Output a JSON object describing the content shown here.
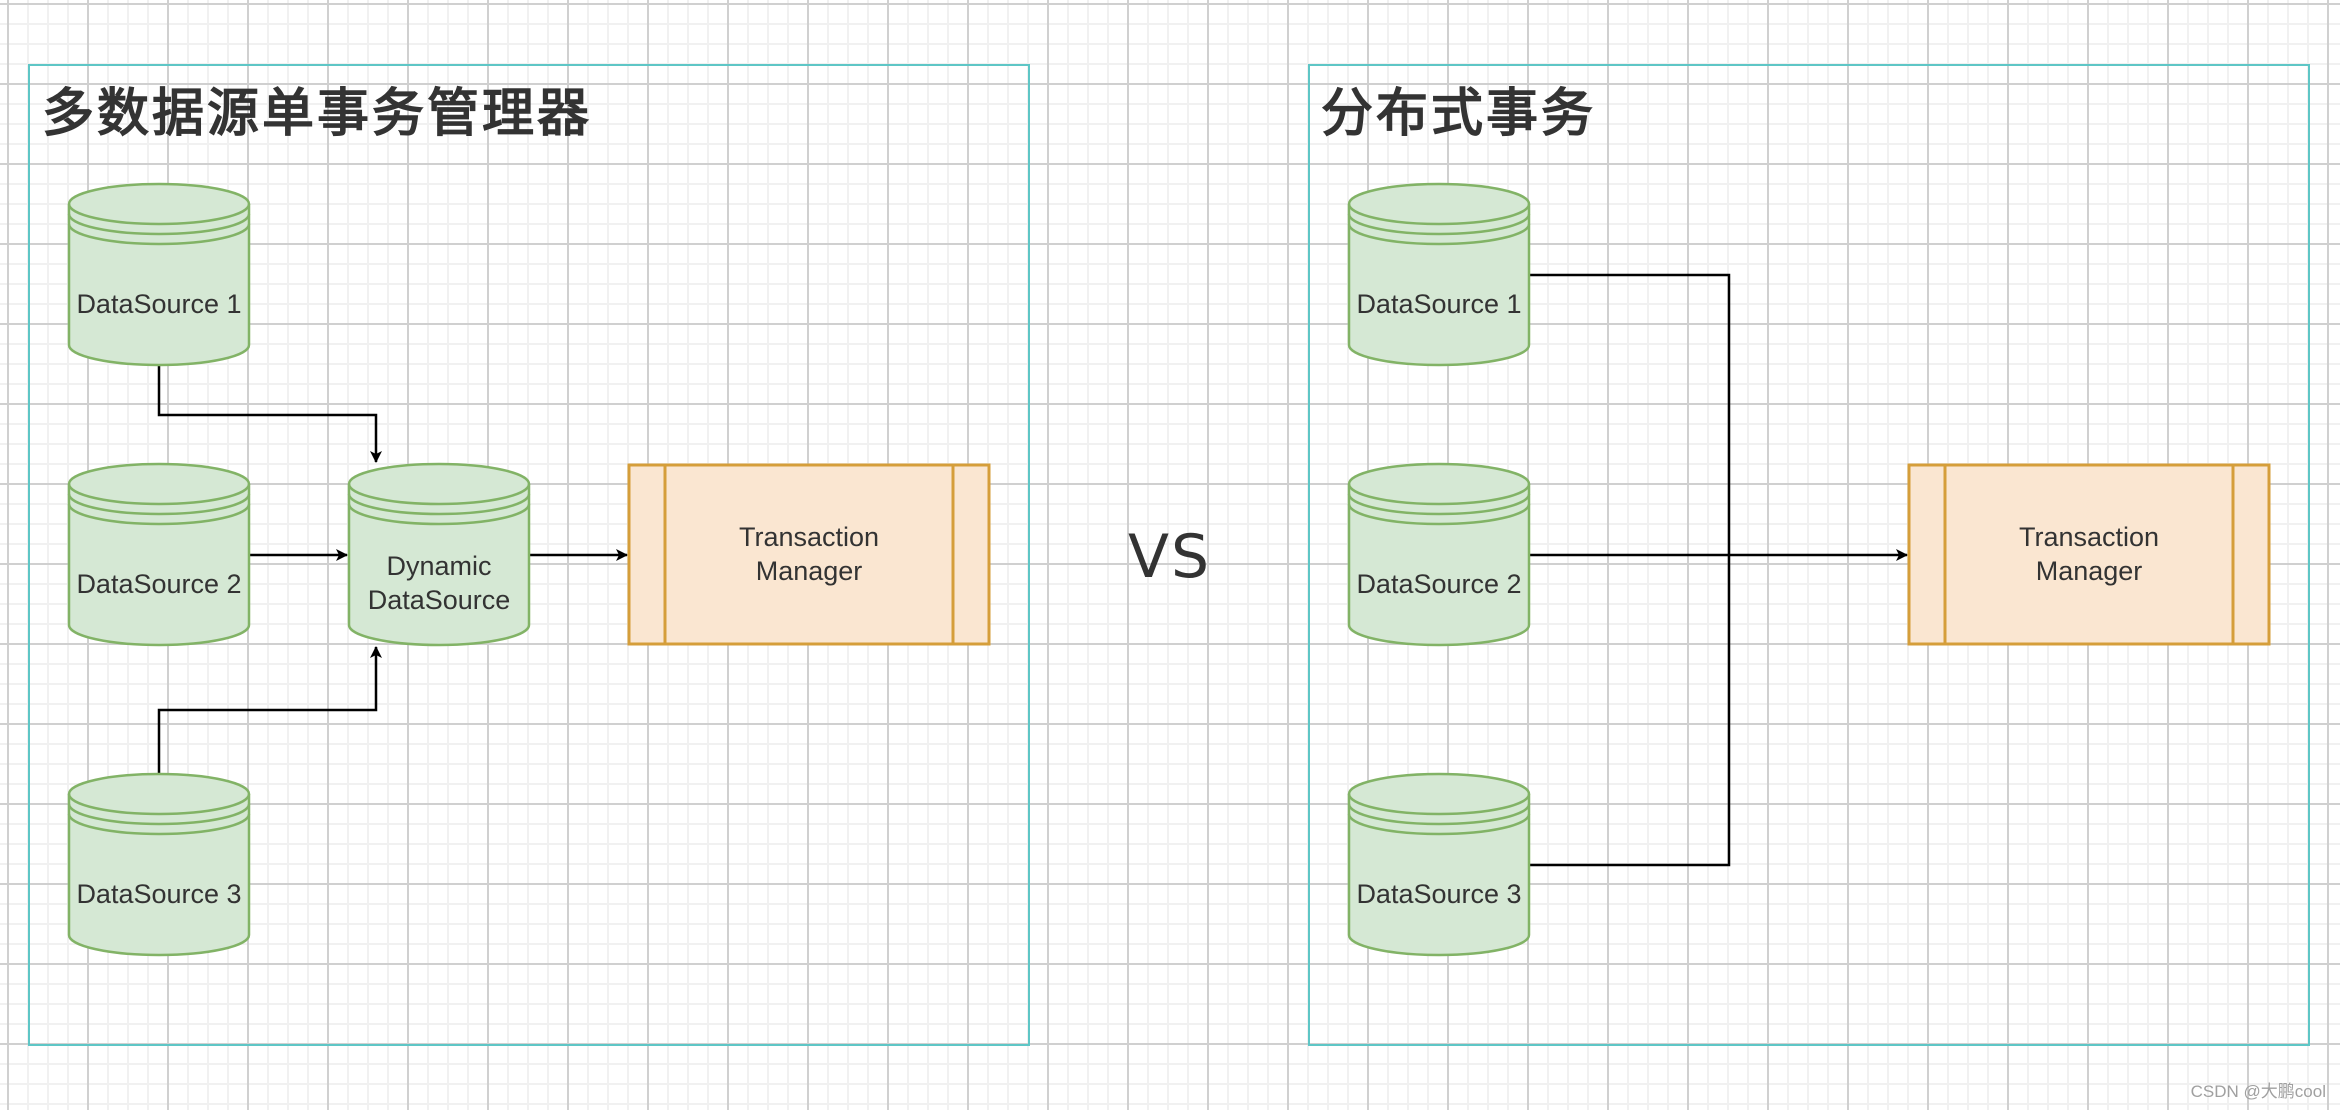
{
  "colors": {
    "frame": "#5ec6c6",
    "db_fill": "#d5e8d4",
    "db_stroke": "#82b366",
    "tm_fill": "#fae6d1",
    "tm_stroke": "#d59e3a",
    "edge": "#000000",
    "text": "#333333"
  },
  "left_panel": {
    "title": "多数据源单事务管理器",
    "nodes": {
      "ds1": "DataSource 1",
      "ds2": "DataSource 2",
      "ds3": "DataSource 3",
      "dynamic": "Dynamic\nDataSource",
      "tm": "Transaction\nManager"
    },
    "edges": [
      {
        "from": "ds1",
        "to": "dynamic"
      },
      {
        "from": "ds2",
        "to": "dynamic"
      },
      {
        "from": "ds3",
        "to": "dynamic"
      },
      {
        "from": "dynamic",
        "to": "tm"
      }
    ]
  },
  "separator": "VS",
  "right_panel": {
    "title": "分布式事务",
    "nodes": {
      "ds1": "DataSource 1",
      "ds2": "DataSource 2",
      "ds3": "DataSource 3",
      "tm": "Transaction\nManager"
    },
    "edges": [
      {
        "from": "ds1",
        "to": "tm"
      },
      {
        "from": "ds2",
        "to": "tm"
      },
      {
        "from": "ds3",
        "to": "tm"
      }
    ]
  },
  "watermark": "CSDN @大鹏cool"
}
